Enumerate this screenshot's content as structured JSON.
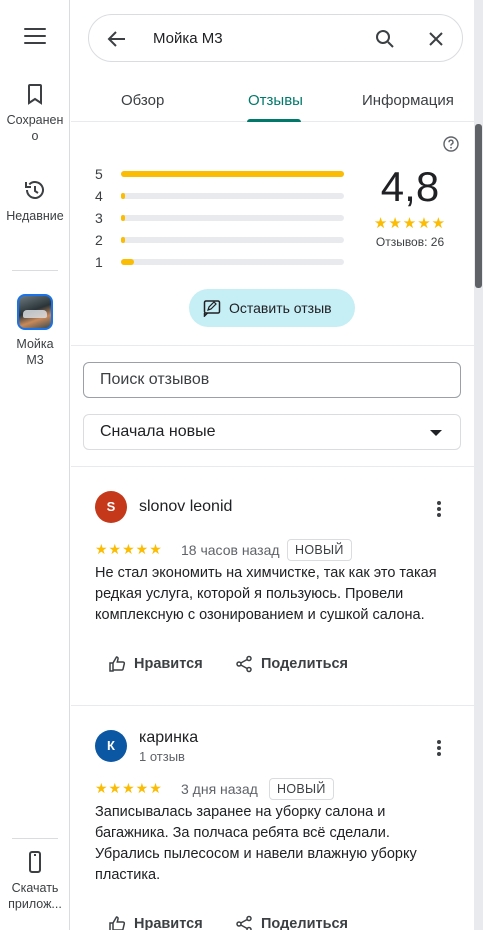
{
  "rail": {
    "saved_label": "Сохранено",
    "recent_label": "Недавние",
    "place_label": "Мойка М3",
    "download_label": "Скачать прилож..."
  },
  "search": {
    "query": "Мойка М3"
  },
  "tabs": [
    {
      "label": "Обзор",
      "active": false
    },
    {
      "label": "Отзывы",
      "active": true
    },
    {
      "label": "Информация",
      "active": false
    }
  ],
  "rating": {
    "value": "4,8",
    "count_text": "Отзывов: 26",
    "stars": "★★★★★",
    "distribution": [
      {
        "stars": "5",
        "fraction": 1.0
      },
      {
        "stars": "4",
        "fraction": 0.02
      },
      {
        "stars": "3",
        "fraction": 0.02
      },
      {
        "stars": "2",
        "fraction": 0.02
      },
      {
        "stars": "1",
        "fraction": 0.06
      }
    ]
  },
  "write_review_label": "Оставить отзыв",
  "review_search_placeholder": "Поиск отзывов",
  "sort_label": "Сначала новые",
  "reviews": [
    {
      "initial": "S",
      "avatar_color": "#c5391a",
      "name": "slonov leonid",
      "subtitle": "",
      "stars": "★★★★★",
      "when": "18 часов назад",
      "badge": "НОВЫЙ",
      "text": "Не стал экономить на химчистке, так как это такая редкая услуга, которой я пользуюсь. Провели комплексную с озонированием и сушкой салона.",
      "like_label": "Нравится",
      "share_label": "Поделиться"
    },
    {
      "initial": "К",
      "avatar_color": "#0b57a4",
      "name": "каринка",
      "subtitle": "1 отзыв",
      "stars": "★★★★★",
      "when": "3 дня назад",
      "badge": "НОВЫЙ",
      "text": "Записывалась заранее на уборку салона и багажника. За полчаса ребята всё сделали. Убрались пылесосом и навели влажную уборку пластика.",
      "like_label": "Нравится",
      "share_label": "Поделиться"
    }
  ],
  "colors": {
    "accent": "#00796b",
    "star": "#fbbc04",
    "button_bg": "#c6eef5"
  }
}
